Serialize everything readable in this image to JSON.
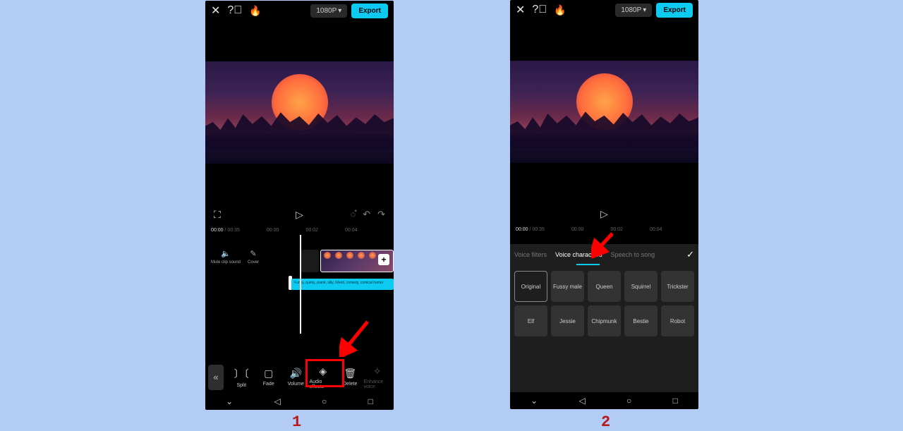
{
  "topbar": {
    "resolution": "1080P",
    "export": "Export"
  },
  "time": {
    "current": "00:00",
    "total": "00:35",
    "marks": [
      "00:00",
      "00:02",
      "00:04"
    ]
  },
  "screen1": {
    "mute": "Mute clip sound",
    "cover": "Cover",
    "audio_label": "Funny, quirky, prank, silly, Weird, comedy, comical humor",
    "tools": {
      "split": "Split",
      "fade": "Fade",
      "volume": "Volume",
      "audio_effects": "Audio effects",
      "delete": "Delete",
      "enhance": "Enhance voice"
    }
  },
  "screen2": {
    "timeA": "00:00",
    "timeB": "00:35",
    "tabs": {
      "voice_filters": "Voice filters",
      "voice_characters": "Voice characters",
      "speech": "Speech to song"
    },
    "voices": {
      "original": "Original",
      "fussy": "Fussy male",
      "queen": "Queen",
      "squirrel": "Squirrel",
      "trickster": "Trickster",
      "elf": "Elf",
      "jessie": "Jessie",
      "chipmunk": "Chipmunk",
      "bestie": "Bestie",
      "robot": "Robot"
    }
  },
  "captions": {
    "one": "1",
    "two": "2"
  },
  "annotation": {
    "color": "#ff0000"
  }
}
